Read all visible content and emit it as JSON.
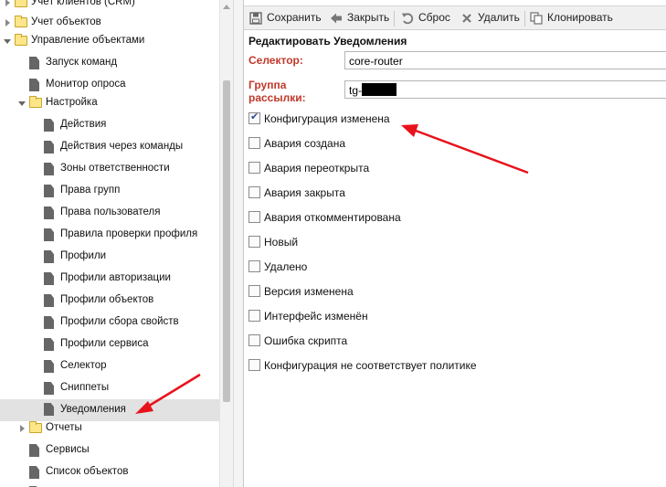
{
  "tree": {
    "items": [
      {
        "label": "Учёт клиентов (CRM)",
        "kind": "folder",
        "state": "closed"
      },
      {
        "label": "Учет объектов",
        "kind": "folder",
        "state": "closed"
      },
      {
        "label": "Управление объектами",
        "kind": "folder",
        "state": "open"
      },
      {
        "label": "Запуск команд",
        "kind": "leaf"
      },
      {
        "label": "Монитор опроса",
        "kind": "leaf"
      },
      {
        "label": "Настройка",
        "kind": "folder",
        "state": "open"
      },
      {
        "label": "Действия",
        "kind": "leaf"
      },
      {
        "label": "Действия через команды",
        "kind": "leaf"
      },
      {
        "label": "Зоны ответственности",
        "kind": "leaf"
      },
      {
        "label": "Права групп",
        "kind": "leaf"
      },
      {
        "label": "Права пользователя",
        "kind": "leaf"
      },
      {
        "label": "Правила проверки профиля",
        "kind": "leaf"
      },
      {
        "label": "Профили",
        "kind": "leaf"
      },
      {
        "label": "Профили авторизации",
        "kind": "leaf"
      },
      {
        "label": "Профили объектов",
        "kind": "leaf"
      },
      {
        "label": "Профили сбора свойств",
        "kind": "leaf"
      },
      {
        "label": "Профили сервиса",
        "kind": "leaf"
      },
      {
        "label": "Селектор",
        "kind": "leaf"
      },
      {
        "label": "Сниппеты",
        "kind": "leaf"
      },
      {
        "label": "Уведомления",
        "kind": "leaf",
        "selected": true
      },
      {
        "label": "Отчеты",
        "kind": "folder",
        "state": "closed"
      },
      {
        "label": "Сервисы",
        "kind": "leaf"
      },
      {
        "label": "Список объектов",
        "kind": "leaf"
      }
    ]
  },
  "toolbar": {
    "save": "Сохранить",
    "close": "Закрыть",
    "reset": "Сброс",
    "delete": "Удалить",
    "clone": "Клонировать"
  },
  "form": {
    "title": "Редактировать Уведомления",
    "selector_label": "Селектор:",
    "selector_value": "core-router",
    "group_label_line1": "Группа",
    "group_label_line2": "рассылки:",
    "group_value_prefix": "tg-",
    "checkboxes": [
      {
        "label": "Конфигурация изменена",
        "checked": true
      },
      {
        "label": "Авария создана",
        "checked": false
      },
      {
        "label": "Авария переоткрыта",
        "checked": false
      },
      {
        "label": "Авария закрыта",
        "checked": false
      },
      {
        "label": "Авария откомментирована",
        "checked": false
      },
      {
        "label": "Новый",
        "checked": false
      },
      {
        "label": "Удалено",
        "checked": false
      },
      {
        "label": "Версия изменена",
        "checked": false
      },
      {
        "label": "Интерфейс изменён",
        "checked": false
      },
      {
        "label": "Ошибка скрипта",
        "checked": false
      },
      {
        "label": "Конфигурация не соответствует политике",
        "checked": false
      }
    ]
  },
  "colors": {
    "field_label": "#c0392b",
    "annotation_arrow": "#e8121b",
    "selected_row": "#e2e2e2"
  }
}
